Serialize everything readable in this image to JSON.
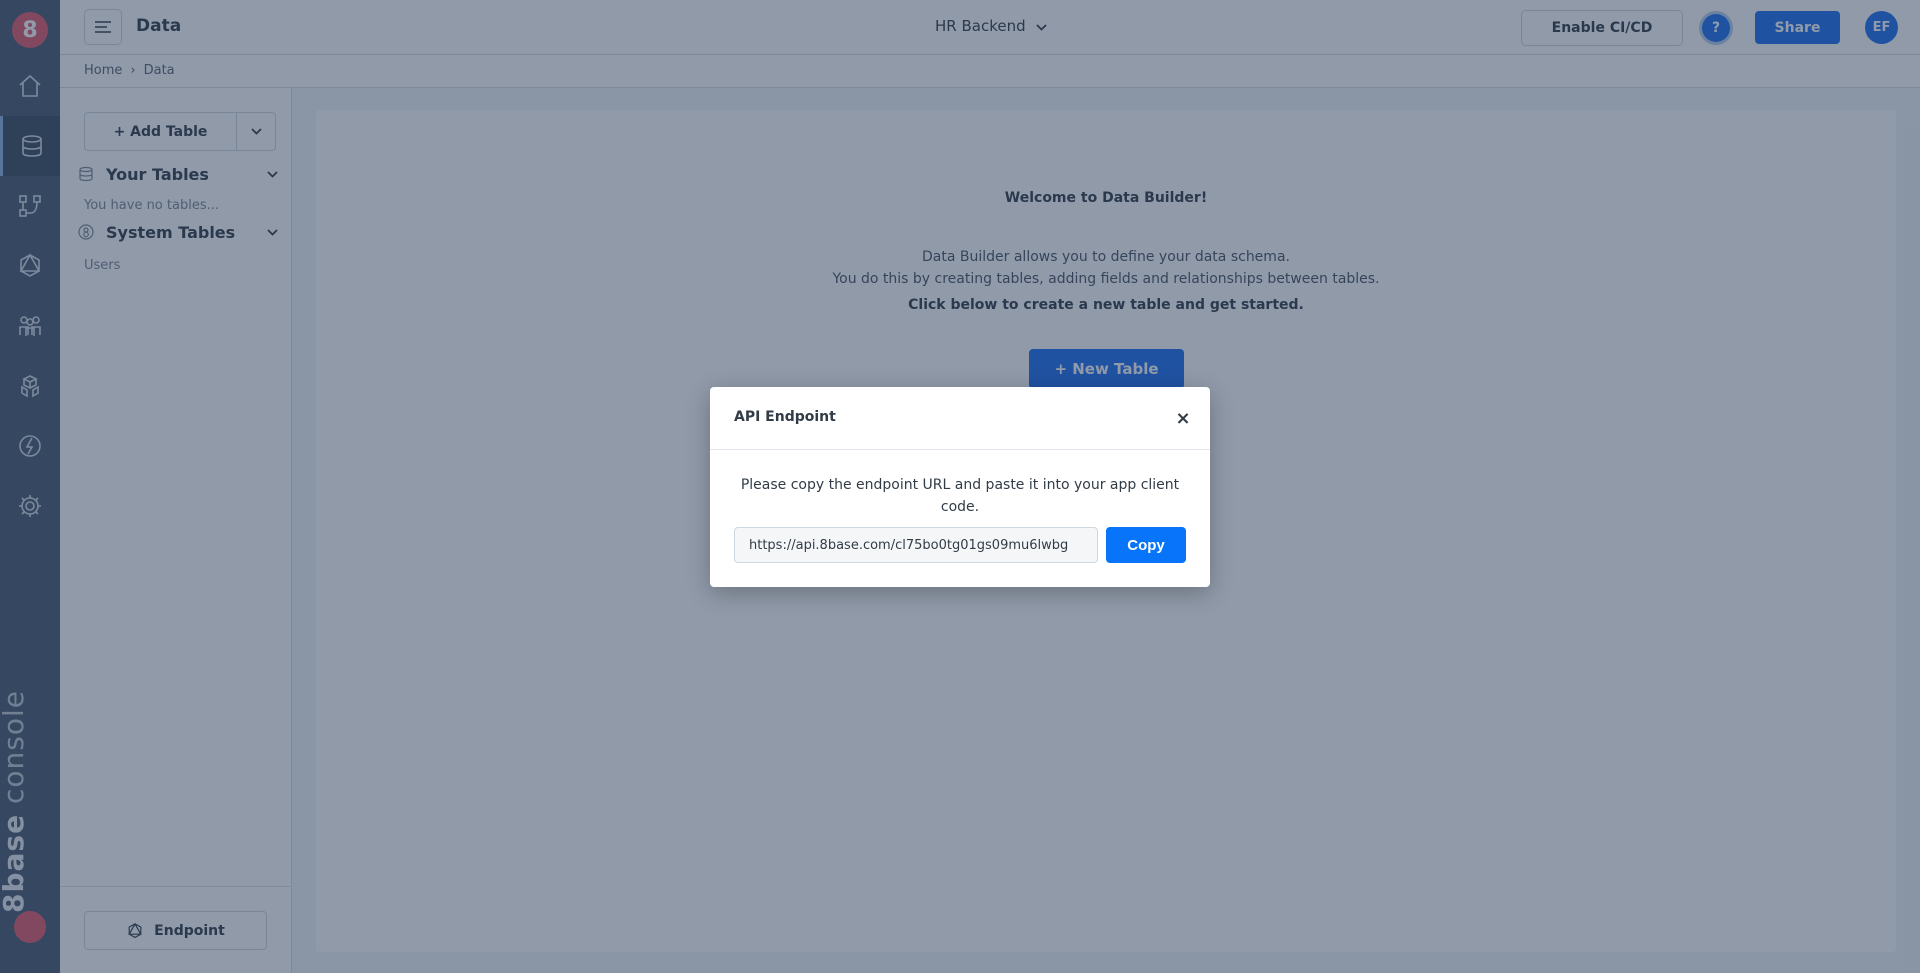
{
  "rail": {
    "logo_text": "8",
    "icons": [
      "home-icon",
      "database-icon",
      "flow-icon",
      "graphql-icon",
      "users-icon",
      "packages-icon",
      "functions-icon",
      "settings-icon"
    ],
    "brand_bold": "8base",
    "brand_light": "console"
  },
  "header": {
    "page_title": "Data",
    "project_name": "HR Backend",
    "cicd_label": "Enable CI/CD",
    "help_label": "?",
    "share_label": "Share",
    "avatar_initials": "EF"
  },
  "breadcrumb": {
    "items": [
      "Home",
      "Data"
    ],
    "separator": "›"
  },
  "sidebar": {
    "add_table_label": "+ Add Table",
    "your_tables": {
      "label": "Your Tables",
      "empty_text": "You have no tables..."
    },
    "system_tables": {
      "label": "System Tables",
      "items": [
        "Users"
      ]
    },
    "endpoint_label": "Endpoint"
  },
  "main": {
    "welcome_title": "Welcome to Data Builder!",
    "description_line1": "Data Builder allows you to define your data schema.",
    "description_line2": "You do this by creating tables, adding fields and relationships between tables.",
    "cta_text": "Click below to create a new table and get started.",
    "new_table_label": "+ New Table"
  },
  "modal": {
    "title": "API Endpoint",
    "close_label": "×",
    "message": "Please copy the endpoint URL and paste it into your app client code.",
    "endpoint_url": "https://api.8base.com/cl75bo0tg01gs09mu6lwbg",
    "copy_label": "Copy"
  },
  "colors": {
    "primary": "#1e6ff0",
    "copy_button": "#0874f9",
    "rail": "#4a5a6e",
    "brand_red": "#e35b6b",
    "overlay": "rgba(33,53,84,0.5)"
  }
}
